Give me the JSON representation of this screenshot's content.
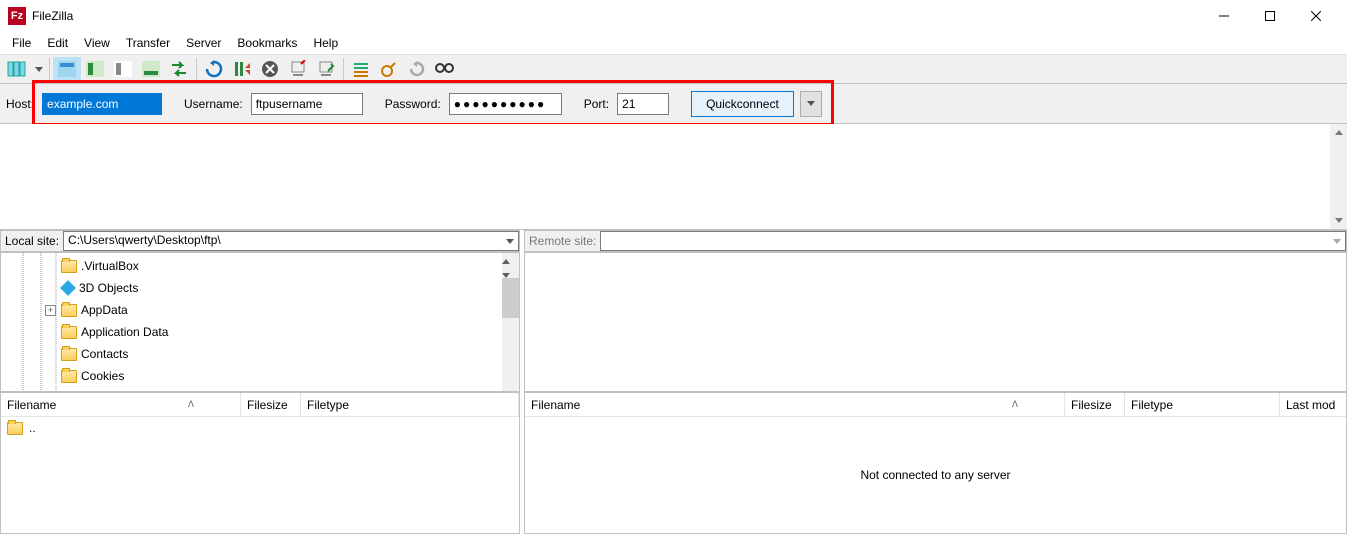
{
  "title": "FileZilla",
  "menus": [
    "File",
    "Edit",
    "View",
    "Transfer",
    "Server",
    "Bookmarks",
    "Help"
  ],
  "quickconnect": {
    "host_label": "Host:",
    "host_value": "example.com",
    "user_label": "Username:",
    "user_value": "ftpusername",
    "pass_label": "Password:",
    "pass_value": "●●●●●●●●●●",
    "port_label": "Port:",
    "port_value": "21",
    "button_label": "Quickconnect"
  },
  "local": {
    "site_label": "Local site:",
    "site_value": "C:\\Users\\qwerty\\Desktop\\ftp\\",
    "tree": [
      {
        "icon": "folder",
        "label": ".VirtualBox"
      },
      {
        "icon": "cube",
        "label": "3D Objects"
      },
      {
        "icon": "folder",
        "label": "AppData",
        "expandable": true
      },
      {
        "icon": "folder",
        "label": "Application Data"
      },
      {
        "icon": "folder",
        "label": "Contacts"
      },
      {
        "icon": "folder",
        "label": "Cookies"
      }
    ],
    "cols": [
      "Filename",
      "Filesize",
      "Filetype"
    ],
    "rows": [
      ".."
    ]
  },
  "remote": {
    "site_label": "Remote site:",
    "site_value": "",
    "cols": [
      "Filename",
      "Filesize",
      "Filetype",
      "Last mod"
    ],
    "empty": "Not connected to any server"
  }
}
